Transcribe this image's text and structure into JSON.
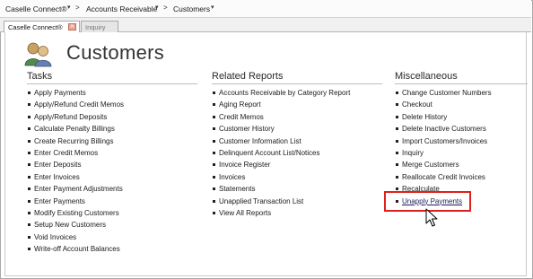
{
  "breadcrumb": {
    "app": "Caselle Connect®",
    "section": "Accounts Receivable",
    "page": "Customers",
    "separator": ">",
    "dropdown_glyph": "▾"
  },
  "tabs": [
    {
      "label": "Caselle Connect®",
      "active": true,
      "closable": true
    },
    {
      "label": "Inquiry",
      "active": false
    }
  ],
  "page": {
    "title": "Customers",
    "icon": "customers-people-icon"
  },
  "columns": {
    "tasks": {
      "heading": "Tasks",
      "items": [
        "Apply Payments",
        "Apply/Refund Credit Memos",
        "Apply/Refund Deposits",
        "Calculate Penalty Billings",
        "Create Recurring Billings",
        "Enter Credit Memos",
        "Enter Deposits",
        "Enter Invoices",
        "Enter Payment Adjustments",
        "Enter Payments",
        "Modify Existing Customers",
        "Setup New Customers",
        "Void Invoices",
        "Write-off Account Balances"
      ]
    },
    "reports": {
      "heading": "Related Reports",
      "items": [
        "Accounts Receivable by Category Report",
        "Aging Report",
        "Credit Memos",
        "Customer History",
        "Customer Information List",
        "Delinquent Account List/Notices",
        "Invoice Register",
        "Invoices",
        "Statements",
        "Unapplied Transaction List",
        "View All Reports"
      ]
    },
    "misc": {
      "heading": "Miscellaneous",
      "items": [
        "Change Customer Numbers",
        "Checkout",
        "Delete History",
        "Delete Inactive Customers",
        "Import Customers/Invoices",
        "Inquiry",
        "Merge Customers",
        "Reallocate Credit Invoices",
        "Recalculate",
        "Unapply Payments"
      ]
    }
  },
  "colors": {
    "highlight": "#e0201c",
    "text": "#1b1b1b",
    "tab_close": "#e9a79a"
  }
}
